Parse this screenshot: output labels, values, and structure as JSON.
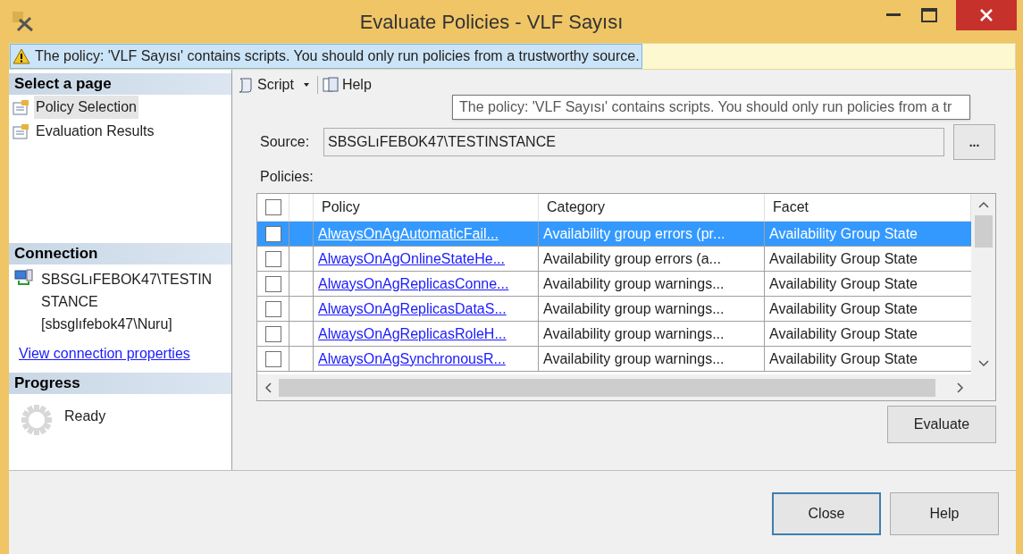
{
  "window": {
    "title": "Evaluate Policies - VLF Sayısı"
  },
  "warning": {
    "text": "The policy: 'VLF Sayısı' contains scripts. You should only run policies from a trustworthy source."
  },
  "sidebar": {
    "heading": "Select a page",
    "items": [
      {
        "label": "Policy Selection",
        "selected": true
      },
      {
        "label": "Evaluation Results",
        "selected": false
      }
    ],
    "connection": {
      "heading": "Connection",
      "server": "SBSGLıFEBOK47\\TESTINSTANCE",
      "user": "[sbsglıfebok47\\Nuru]",
      "link": "View connection properties"
    },
    "progress": {
      "heading": "Progress",
      "status": "Ready"
    }
  },
  "toolbar": {
    "script": "Script",
    "help": "Help"
  },
  "tooltip": {
    "text": "The policy: 'VLF Sayısı' contains scripts. You should only run policies from a tr"
  },
  "source": {
    "label": "Source:",
    "value": "SBSGLıFEBOK47\\TESTINSTANCE",
    "browse": "..."
  },
  "policies": {
    "label": "Policies:",
    "header_checked": false,
    "columns": [
      "Policy",
      "Category",
      "Facet"
    ],
    "rows": [
      {
        "policy": "AlwaysOnAgAutomaticFail...",
        "category": "Availability group errors (pr...",
        "facet": "Availability Group State",
        "checked": false,
        "selected": true
      },
      {
        "policy": "AlwaysOnAgOnlineStateHe...",
        "category": "Availability group errors (a...",
        "facet": "Availability Group State",
        "checked": false,
        "selected": false
      },
      {
        "policy": "AlwaysOnAgReplicasConne...",
        "category": "Availability group warnings...",
        "facet": "Availability Group State",
        "checked": false,
        "selected": false
      },
      {
        "policy": "AlwaysOnAgReplicasDataS...",
        "category": "Availability group warnings...",
        "facet": "Availability Group State",
        "checked": false,
        "selected": false
      },
      {
        "policy": "AlwaysOnAgReplicasRoleH...",
        "category": "Availability group warnings...",
        "facet": "Availability Group State",
        "checked": false,
        "selected": false
      },
      {
        "policy": "AlwaysOnAgSynchronousR...",
        "category": "Availability group warnings...",
        "facet": "Availability Group State",
        "checked": false,
        "selected": false
      }
    ]
  },
  "evaluate": "Evaluate",
  "buttons": [
    {
      "label": "Close",
      "default": true
    },
    {
      "label": "Help",
      "default": false
    }
  ]
}
